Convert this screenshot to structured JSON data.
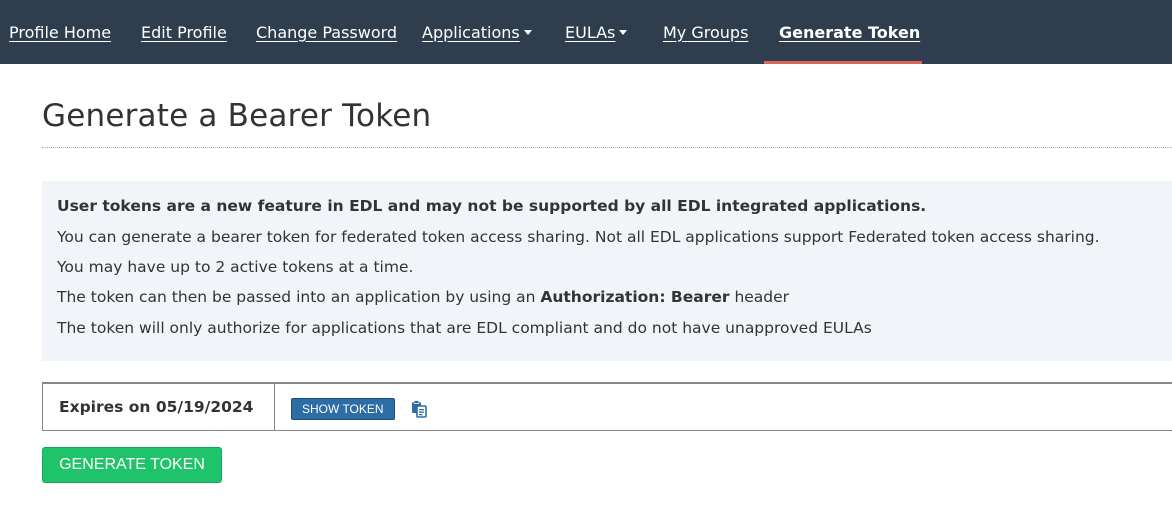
{
  "nav": {
    "items": [
      {
        "label": "Profile Home",
        "dropdown": false,
        "active": false
      },
      {
        "label": "Edit Profile",
        "dropdown": false,
        "active": false
      },
      {
        "label": "Change Password",
        "dropdown": false,
        "active": false
      },
      {
        "label": "Applications",
        "dropdown": true,
        "active": false
      },
      {
        "label": "EULAs",
        "dropdown": true,
        "active": false
      },
      {
        "label": "My Groups",
        "dropdown": false,
        "active": false
      },
      {
        "label": "Generate Token",
        "dropdown": false,
        "active": true
      }
    ]
  },
  "page": {
    "title": "Generate a Bearer Token"
  },
  "info": {
    "notice": "User tokens are a new feature in EDL and may not be supported by all EDL integrated applications.",
    "line1": "You can generate a bearer token for federated token access sharing. Not all EDL applications support Federated token access sharing.",
    "line2": "You may have up to 2 active tokens at a time.",
    "line3_prefix": "The token can then be passed into an application by using an ",
    "line3_bold": "Authorization: Bearer",
    "line3_suffix": " header",
    "line4": "The token will only authorize for applications that are EDL compliant and do not have unapproved EULAs"
  },
  "tokens": [
    {
      "expires": "Expires on 05/19/2024",
      "show_label": "SHOW TOKEN",
      "copy_icon": "copy-icon"
    }
  ],
  "actions": {
    "generate_label": "GENERATE TOKEN"
  },
  "colors": {
    "nav_bg": "#2f3e4e",
    "active_underline": "#e0635a",
    "info_bg": "#f1f5f9",
    "show_token_bg": "#2d6da5",
    "generate_bg": "#1fc46a"
  }
}
